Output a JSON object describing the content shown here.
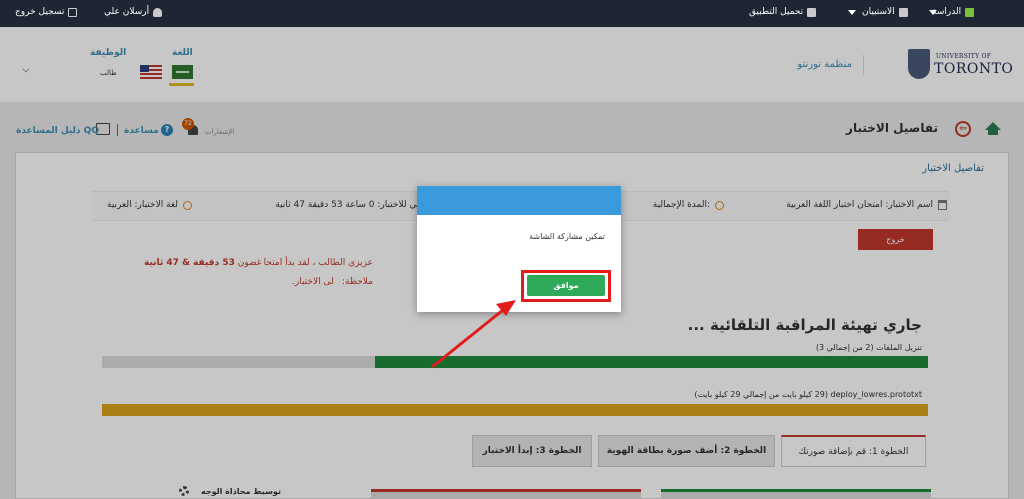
{
  "topbar": {
    "study": "الدراسة",
    "surveys": "الاستبيان",
    "download": "تحميل التطبيق",
    "user": "أرسلان علي",
    "logout": "تسجيل خروج"
  },
  "header": {
    "logo_university": "UNIVERSITY OF",
    "logo_toronto": "TORONTO",
    "organization": "منظمة تورنتو",
    "language_label": "اللغة",
    "role_label": "الوظيفة",
    "role_value": "طالب"
  },
  "titlebar": {
    "title": "تفاصيل الاختبار",
    "notifications_label": "الإشعارات",
    "notifications_count": "72",
    "help": "مساعدة",
    "help_mark": "?",
    "guide": "دليل المساعدة QQ",
    "back_glyph": "⇦"
  },
  "card": {
    "title": "تفاصيل الاختبار",
    "exam_name": "اسم الاختبار: امتحان اختبار اللغة العربية",
    "total_duration": "المدة الإجمالية:",
    "remaining": "بقي للاختبار: 0 ساعة 53 دقيقة 47 ثانية",
    "exam_language": "لغة الاختبار: العربية",
    "exit_button": "خروج",
    "warning_line1_a": "عزيزي الطالب ، لقد بدأ امتحا",
    "warning_line1_b": "غضون ",
    "warning_line1_bold": "53 دقيقة & 47 ثانية",
    "warning_line2_a": "ملاحظة:",
    "warning_line2_b": "لى الاختبار."
  },
  "proctoring": {
    "title": "جاري تهيئة المراقبة التلقائية ...",
    "files_label": "تنزيل الملفات (2 من إجمالي 3)",
    "files_progress": 0.67,
    "file_name": "deploy_lowres.prototxt (29 كيلو بايت من إجمالي 29 كيلو بايت)",
    "file_progress": 1.0
  },
  "tabs": [
    {
      "label": "الخطوة 1: قم بإضافة صورتك"
    },
    {
      "label": "الخطوة 2: أضف صورة بطاقة الهوية"
    },
    {
      "label": "الخطوة 3: إبدأ الاختبار"
    }
  ],
  "face": {
    "label": "توسيط محاذاة الوجه"
  },
  "modal": {
    "message": "تمكين مشاركة الشاشة",
    "ok_button": "موافق"
  },
  "colors": {
    "topbar": "#1e2533",
    "accent": "#3d8fb3",
    "danger": "#c0392b",
    "success": "#2eaa5a",
    "modal_header": "#3a9bdc",
    "progress_green": "#1f8a3c",
    "progress_yellow": "#d8a51c"
  }
}
